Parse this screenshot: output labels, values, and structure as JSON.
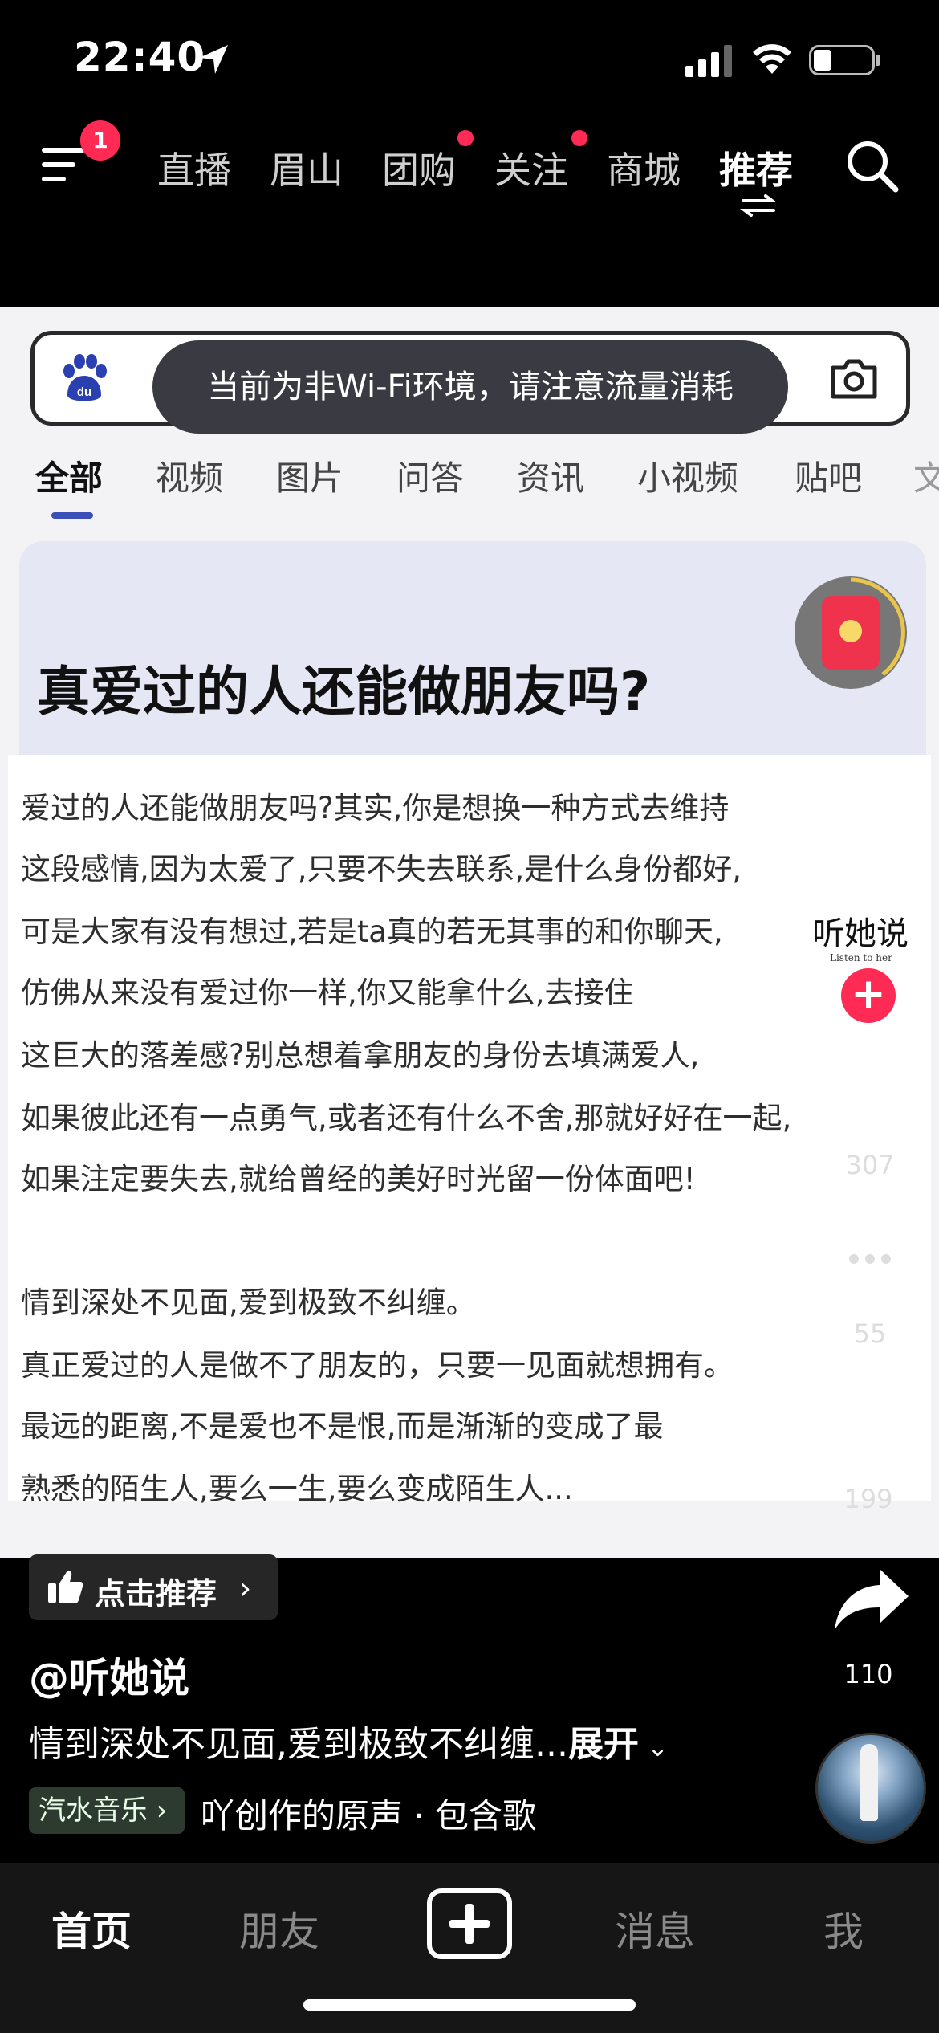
{
  "status_bar": {
    "time": "22:40"
  },
  "top_nav": {
    "menu_badge": "1",
    "tabs": [
      {
        "label": "直播",
        "dot": false
      },
      {
        "label": "眉山",
        "dot": false
      },
      {
        "label": "团购",
        "dot": true
      },
      {
        "label": "关注",
        "dot": true
      },
      {
        "label": "商城",
        "dot": false
      },
      {
        "label": "推荐",
        "dot": false,
        "active": true
      }
    ]
  },
  "video": {
    "toast": "当前为非Wi-Fi环境，请注意流量消耗",
    "categories": [
      "全部",
      "视频",
      "图片",
      "问答",
      "资讯",
      "小视频",
      "贴吧",
      "文"
    ],
    "headline": "真爱过的人还能做朋友吗?",
    "paragraph_lines": [
      "爱过的人还能做朋友吗?其实,你是想换一种方式去维持",
      "这段感情,因为太爱了,只要不失去联系,是什么身份都好,",
      "可是大家有没有想过,若是ta真的若无其事的和你聊天,",
      "仿佛从来没有爱过你一样,你又能拿什么,去接住",
      "这巨大的落差感?别总想着拿朋友的身份去填满爱人,",
      "如果彼此还有一点勇气,或者还有什么不舍,那就好好在一起,",
      "如果注定要失去,就给曾经的美好时光留一份体面吧!",
      "",
      "情到深处不见面,爱到极致不纠缠。",
      "真正爱过的人是做不了朋友的，只要一见面就想拥有。",
      "最远的距离,不是爱也不是恨,而是渐渐的变成了最",
      "熟悉的陌生人,要么一生,要么变成陌生人..."
    ],
    "watermark": "听她说",
    "watermark_sub": "Listen to her"
  },
  "actions": {
    "like_count": "307",
    "comment_count": "55",
    "favorite_count": "199",
    "share_count": "110"
  },
  "info": {
    "recommend_label": "点击推荐",
    "author": "@听她说",
    "caption": "情到深处不见面,爱到极致不纠缠...",
    "caption_more": "展开",
    "music_tag": "汽水音乐",
    "music_text": "吖创作的原声 · 包含歌"
  },
  "tab_bar": {
    "home": "首页",
    "friends": "朋友",
    "messages": "消息",
    "me": "我"
  },
  "colors": {
    "accent": "#ff2b55",
    "background": "#000000",
    "toast_bg": "#3a3b42"
  }
}
